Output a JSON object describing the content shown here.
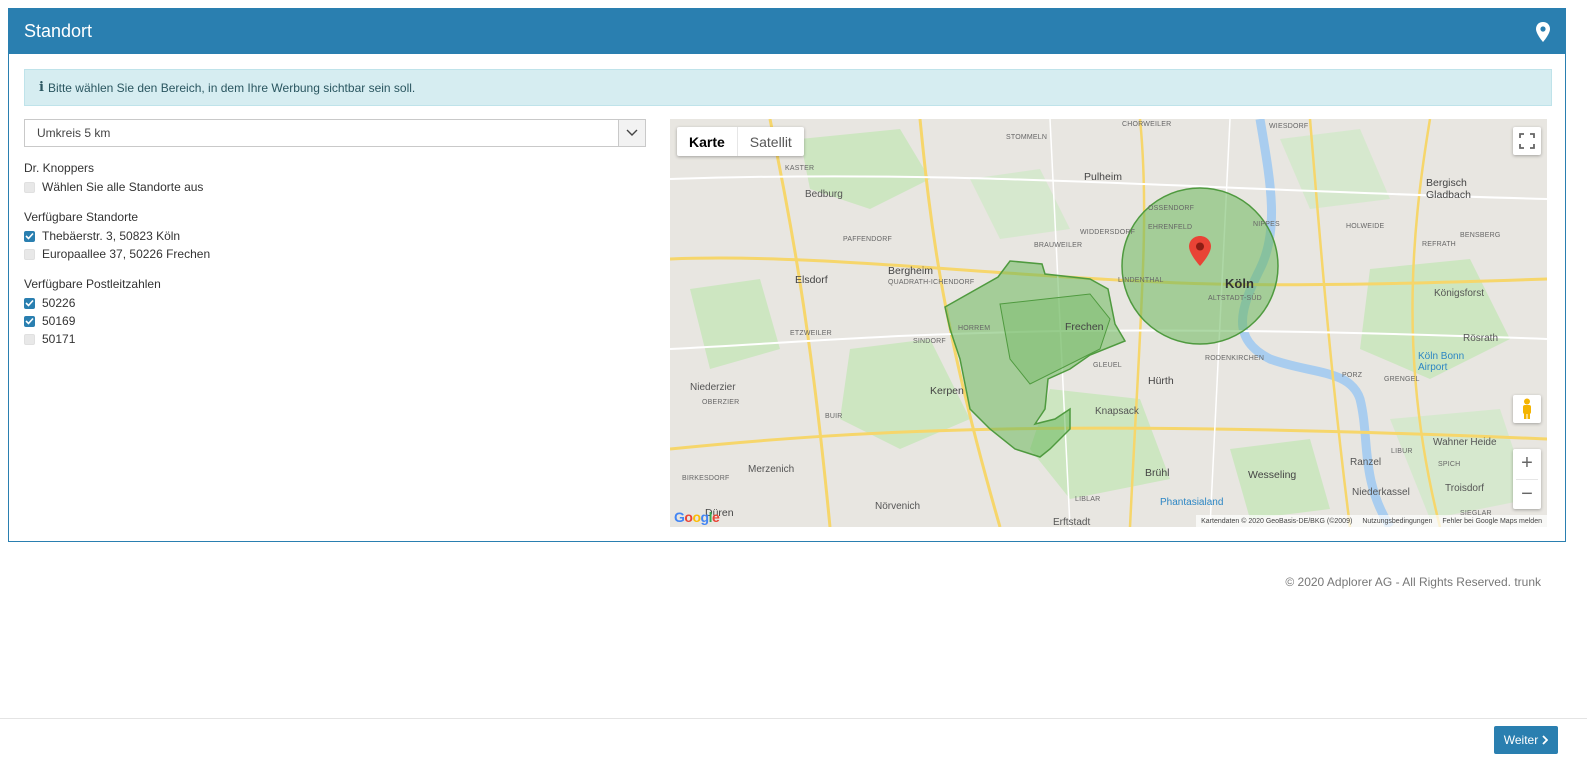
{
  "header": {
    "title": "Standort",
    "icon": "map-marker-icon"
  },
  "alert": {
    "icon": "info-icon",
    "text": "Bitte wählen Sie den Bereich, in dem Ihre Werbung sichtbar sein soll."
  },
  "radius_select": {
    "value": "Umkreis 5 km",
    "icon": "chevron-down-icon"
  },
  "company": {
    "name": "Dr. Knoppers",
    "select_all": {
      "label": "Wählen Sie alle Standorte aus",
      "checked": false
    }
  },
  "locations": {
    "title": "Verfügbare Standorte",
    "items": [
      {
        "label": "Thebäerstr. 3, 50823 Köln",
        "checked": true
      },
      {
        "label": "Europaallee 37, 50226 Frechen",
        "checked": false
      }
    ]
  },
  "postcodes": {
    "title": "Verfügbare Postleitzahlen",
    "items": [
      {
        "label": "50226",
        "checked": true
      },
      {
        "label": "50169",
        "checked": true
      },
      {
        "label": "50171",
        "checked": false
      }
    ]
  },
  "map": {
    "tabs": [
      "Karte",
      "Satellit"
    ],
    "active_tab": "Karte",
    "labels": {
      "koeln": "Köln",
      "frechen": "Frechen",
      "pulheim": "Pulheim",
      "bergheim": "Bergheim",
      "elsdorf": "Elsdorf",
      "kerpen": "Kerpen",
      "huerth": "Hürth",
      "bruehl": "Brühl",
      "wesseling": "Wesseling",
      "knapsack": "Knapsack",
      "bedburg": "Bedburg",
      "niederzier": "Niederzier",
      "merzenich": "Merzenich",
      "dueren": "Düren",
      "noervenich": "Nörvenich",
      "bergisch_gladbach": "Bergisch\nGladbach",
      "koenigsforst": "Königsforst",
      "roesrath": "Rösrath",
      "wahner_heide": "Wahner Heide",
      "troisdorf": "Troisdorf",
      "niederkassel": "Niederkassel",
      "ranzel": "Ranzel",
      "porz": "PORZ",
      "airport": "Köln Bonn\nAirport",
      "phantasialand": "Phantasialand",
      "lindenthal": "LINDENTHAL",
      "ehrenfeld": "EHRENFELD",
      "nippes": "NIPPES",
      "altstadt": "ALTSTADT-SÜD",
      "rodenkirchen": "RODENKIRCHEN",
      "chorweiler": "CHORWEILER",
      "stommeln": "STOMMELN",
      "kaster": "KASTER",
      "paffendorf": "PAFFENDORF",
      "etzweiler": "ETZWEILER",
      "sindorf": "SINDORF",
      "buir": "BUIR",
      "oberzier": "OBERZIER",
      "birkesdorf": "BIRKESDORF",
      "gleuel": "GLEUEL",
      "liblar": "LIBLAR",
      "erftstadt": "Erftstadt",
      "widdersdorf": "WIDDERSDORF",
      "brauweiler": "BRAUWEILER",
      "quadrath": "QUADRATH-ICHENDORF",
      "horrem": "HORREM",
      "bensberg": "BENSBERG",
      "refrath": "REFRATH",
      "holweide": "HOLWEIDE",
      "wiesdorf": "WIESDORF",
      "bossendorf": "OSSENDORF",
      "libur": "LIBUR",
      "spich": "SPICH",
      "grengel": "GRENGEL",
      "sieglar": "SIEGLAR"
    },
    "copyright": "Kartendaten © 2020 GeoBasis-DE/BKG (©2009)",
    "terms": "Nutzungsbedingungen",
    "report": "Fehler bei Google Maps melden",
    "google": "Google",
    "zoom_in": "+",
    "zoom_out": "−"
  },
  "footer": {
    "text": "© 2020 Adplorer AG - All Rights Reserved. trunk"
  },
  "next_button": {
    "label": "Weiter",
    "icon": "chevron-right-icon"
  },
  "colors": {
    "primary": "#2a7fb0",
    "alert_bg": "#d6edf1",
    "area_fill": "#6cb85c",
    "area_stroke": "#4f9a3f"
  }
}
